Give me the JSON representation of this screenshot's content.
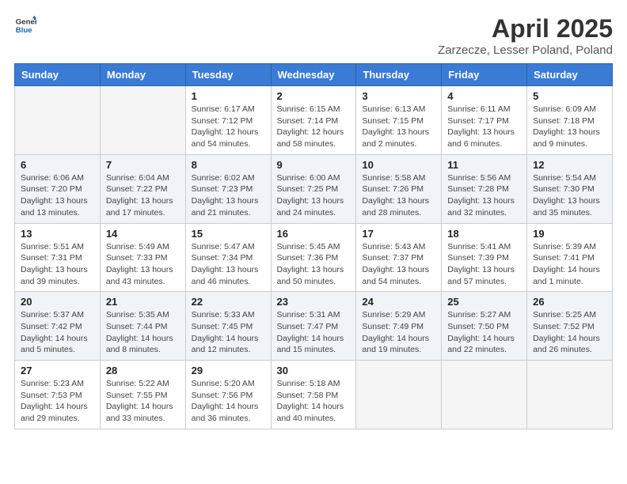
{
  "header": {
    "logo_general": "General",
    "logo_blue": "Blue",
    "title": "April 2025",
    "location": "Zarzecze, Lesser Poland, Poland"
  },
  "weekdays": [
    "Sunday",
    "Monday",
    "Tuesday",
    "Wednesday",
    "Thursday",
    "Friday",
    "Saturday"
  ],
  "weeks": [
    [
      {
        "num": "",
        "detail": ""
      },
      {
        "num": "",
        "detail": ""
      },
      {
        "num": "1",
        "detail": "Sunrise: 6:17 AM\nSunset: 7:12 PM\nDaylight: 12 hours\nand 54 minutes."
      },
      {
        "num": "2",
        "detail": "Sunrise: 6:15 AM\nSunset: 7:14 PM\nDaylight: 12 hours\nand 58 minutes."
      },
      {
        "num": "3",
        "detail": "Sunrise: 6:13 AM\nSunset: 7:15 PM\nDaylight: 13 hours\nand 2 minutes."
      },
      {
        "num": "4",
        "detail": "Sunrise: 6:11 AM\nSunset: 7:17 PM\nDaylight: 13 hours\nand 6 minutes."
      },
      {
        "num": "5",
        "detail": "Sunrise: 6:09 AM\nSunset: 7:18 PM\nDaylight: 13 hours\nand 9 minutes."
      }
    ],
    [
      {
        "num": "6",
        "detail": "Sunrise: 6:06 AM\nSunset: 7:20 PM\nDaylight: 13 hours\nand 13 minutes."
      },
      {
        "num": "7",
        "detail": "Sunrise: 6:04 AM\nSunset: 7:22 PM\nDaylight: 13 hours\nand 17 minutes."
      },
      {
        "num": "8",
        "detail": "Sunrise: 6:02 AM\nSunset: 7:23 PM\nDaylight: 13 hours\nand 21 minutes."
      },
      {
        "num": "9",
        "detail": "Sunrise: 6:00 AM\nSunset: 7:25 PM\nDaylight: 13 hours\nand 24 minutes."
      },
      {
        "num": "10",
        "detail": "Sunrise: 5:58 AM\nSunset: 7:26 PM\nDaylight: 13 hours\nand 28 minutes."
      },
      {
        "num": "11",
        "detail": "Sunrise: 5:56 AM\nSunset: 7:28 PM\nDaylight: 13 hours\nand 32 minutes."
      },
      {
        "num": "12",
        "detail": "Sunrise: 5:54 AM\nSunset: 7:30 PM\nDaylight: 13 hours\nand 35 minutes."
      }
    ],
    [
      {
        "num": "13",
        "detail": "Sunrise: 5:51 AM\nSunset: 7:31 PM\nDaylight: 13 hours\nand 39 minutes."
      },
      {
        "num": "14",
        "detail": "Sunrise: 5:49 AM\nSunset: 7:33 PM\nDaylight: 13 hours\nand 43 minutes."
      },
      {
        "num": "15",
        "detail": "Sunrise: 5:47 AM\nSunset: 7:34 PM\nDaylight: 13 hours\nand 46 minutes."
      },
      {
        "num": "16",
        "detail": "Sunrise: 5:45 AM\nSunset: 7:36 PM\nDaylight: 13 hours\nand 50 minutes."
      },
      {
        "num": "17",
        "detail": "Sunrise: 5:43 AM\nSunset: 7:37 PM\nDaylight: 13 hours\nand 54 minutes."
      },
      {
        "num": "18",
        "detail": "Sunrise: 5:41 AM\nSunset: 7:39 PM\nDaylight: 13 hours\nand 57 minutes."
      },
      {
        "num": "19",
        "detail": "Sunrise: 5:39 AM\nSunset: 7:41 PM\nDaylight: 14 hours\nand 1 minute."
      }
    ],
    [
      {
        "num": "20",
        "detail": "Sunrise: 5:37 AM\nSunset: 7:42 PM\nDaylight: 14 hours\nand 5 minutes."
      },
      {
        "num": "21",
        "detail": "Sunrise: 5:35 AM\nSunset: 7:44 PM\nDaylight: 14 hours\nand 8 minutes."
      },
      {
        "num": "22",
        "detail": "Sunrise: 5:33 AM\nSunset: 7:45 PM\nDaylight: 14 hours\nand 12 minutes."
      },
      {
        "num": "23",
        "detail": "Sunrise: 5:31 AM\nSunset: 7:47 PM\nDaylight: 14 hours\nand 15 minutes."
      },
      {
        "num": "24",
        "detail": "Sunrise: 5:29 AM\nSunset: 7:49 PM\nDaylight: 14 hours\nand 19 minutes."
      },
      {
        "num": "25",
        "detail": "Sunrise: 5:27 AM\nSunset: 7:50 PM\nDaylight: 14 hours\nand 22 minutes."
      },
      {
        "num": "26",
        "detail": "Sunrise: 5:25 AM\nSunset: 7:52 PM\nDaylight: 14 hours\nand 26 minutes."
      }
    ],
    [
      {
        "num": "27",
        "detail": "Sunrise: 5:23 AM\nSunset: 7:53 PM\nDaylight: 14 hours\nand 29 minutes."
      },
      {
        "num": "28",
        "detail": "Sunrise: 5:22 AM\nSunset: 7:55 PM\nDaylight: 14 hours\nand 33 minutes."
      },
      {
        "num": "29",
        "detail": "Sunrise: 5:20 AM\nSunset: 7:56 PM\nDaylight: 14 hours\nand 36 minutes."
      },
      {
        "num": "30",
        "detail": "Sunrise: 5:18 AM\nSunset: 7:58 PM\nDaylight: 14 hours\nand 40 minutes."
      },
      {
        "num": "",
        "detail": ""
      },
      {
        "num": "",
        "detail": ""
      },
      {
        "num": "",
        "detail": ""
      }
    ]
  ]
}
